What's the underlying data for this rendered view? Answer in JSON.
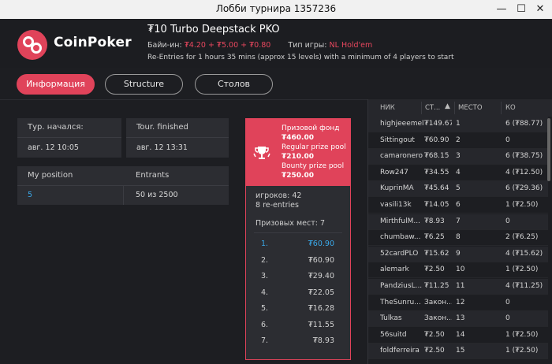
{
  "window": {
    "title": "Лобби турнира 1357236",
    "minimize": "—",
    "maximize": "☐",
    "close": "✕"
  },
  "brand": {
    "name": "CoinPoker"
  },
  "tournament": {
    "name": "₮10 Turbo Deepstack PKO",
    "buyin_label": "Байи-ин:",
    "buyin_value": "₮4.20 + ₮5.00 + ₮0.80",
    "game_label": "Тип игры:",
    "game_value": "NL Hold'em",
    "description": "Re-Entries for 1 hours 35 mins (approx 15 levels) with a minimum of 4 players to start"
  },
  "tabs": [
    {
      "label": "Информация",
      "active": true
    },
    {
      "label": "Structure",
      "active": false
    },
    {
      "label": "Столов",
      "active": false
    }
  ],
  "info": {
    "started_label": "Тур. начался:",
    "started_value": "авг. 12 10:05",
    "finished_label": "Tour. finished",
    "finished_value": "авг. 12 13:31",
    "position_label": "My position",
    "position_value": "5",
    "entrants_label": "Entrants",
    "entrants_value": "50 из 2500"
  },
  "prize": {
    "pool_label": "Призовой фонд",
    "pool_value": "₮460.00",
    "regular_label": "Regular prize pool",
    "regular_value": "₮210.00",
    "bounty_label": "Bounty prize pool",
    "bounty_value": "₮250.00",
    "players": "игроков: 42",
    "reentries": "8 re-entries",
    "places_label": "Призовых мест: 7",
    "places": [
      {
        "n": "1.",
        "v": "₮60.90"
      },
      {
        "n": "2.",
        "v": "₮60.90"
      },
      {
        "n": "3.",
        "v": "₮29.40"
      },
      {
        "n": "4.",
        "v": "₮22.05"
      },
      {
        "n": "5.",
        "v": "₮16.28"
      },
      {
        "n": "6.",
        "v": "₮11.55"
      },
      {
        "n": "7.",
        "v": "₮8.93"
      }
    ]
  },
  "table": {
    "headers": {
      "nick": "НИК",
      "stack": "СТ...",
      "place": "МЕСТО",
      "ko": "КО"
    },
    "rows": [
      {
        "nick": "highjeeemel",
        "stack": "₮149.67",
        "place": "1",
        "ko": "6 (₮88.77)"
      },
      {
        "nick": "Sittingout",
        "stack": "₮60.90",
        "place": "2",
        "ko": "0"
      },
      {
        "nick": "camaronero",
        "stack": "₮68.15",
        "place": "3",
        "ko": "6 (₮38.75)"
      },
      {
        "nick": "Row247",
        "stack": "₮34.55",
        "place": "4",
        "ko": "4 (₮12.50)"
      },
      {
        "nick": "KuprinMA",
        "stack": "₮45.64",
        "place": "5",
        "ko": "6 (₮29.36)"
      },
      {
        "nick": "vasili13k",
        "stack": "₮14.05",
        "place": "6",
        "ko": "1 (₮2.50)"
      },
      {
        "nick": "MirthfulM...",
        "stack": "₮8.93",
        "place": "7",
        "ko": "0"
      },
      {
        "nick": "chumbaw...",
        "stack": "₮6.25",
        "place": "8",
        "ko": "2 (₮6.25)"
      },
      {
        "nick": "52cardPLO",
        "stack": "₮15.62",
        "place": "9",
        "ko": "4 (₮15.62)"
      },
      {
        "nick": "alemark",
        "stack": "₮2.50",
        "place": "10",
        "ko": "1 (₮2.50)"
      },
      {
        "nick": "PandziusL...",
        "stack": "₮11.25",
        "place": "11",
        "ko": "4 (₮11.25)"
      },
      {
        "nick": "TheSunru...",
        "stack": "Закон...",
        "place": "12",
        "ko": "0"
      },
      {
        "nick": "Tulkas",
        "stack": "Закон...",
        "place": "13",
        "ko": "0"
      },
      {
        "nick": "56suitd",
        "stack": "₮2.50",
        "place": "14",
        "ko": "1 (₮2.50)"
      },
      {
        "nick": "foldferreira",
        "stack": "₮2.50",
        "place": "15",
        "ko": "1 (₮2.50)"
      }
    ]
  }
}
